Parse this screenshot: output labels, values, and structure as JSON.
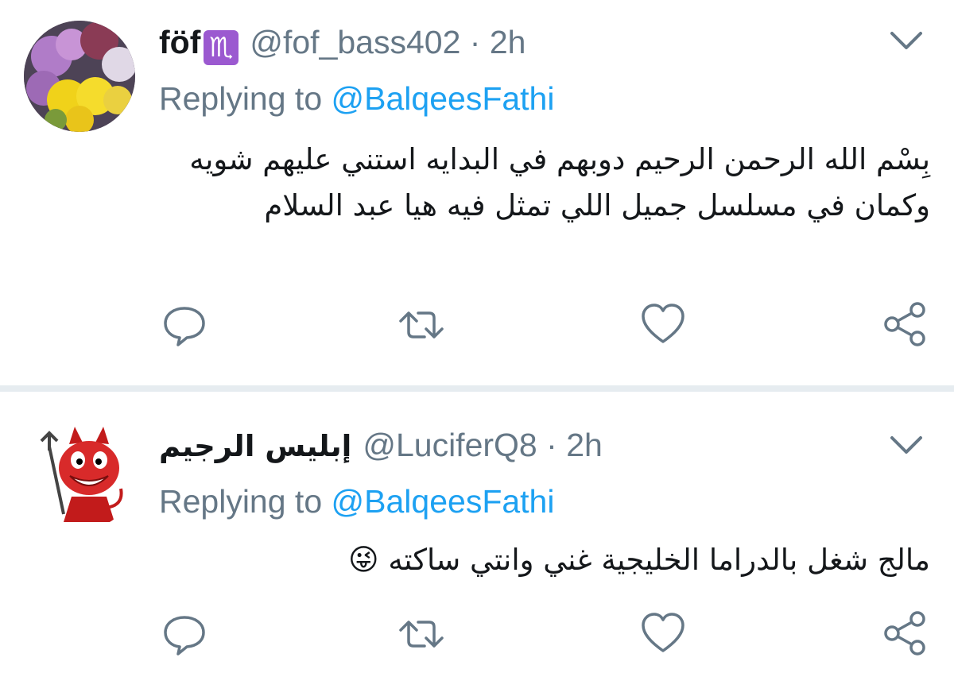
{
  "colors": {
    "text_primary": "#14171a",
    "text_secondary": "#657786",
    "link_blue": "#1da1f2",
    "divider": "#e6ecf0"
  },
  "tweets": [
    {
      "display_name": "föf",
      "badge": "♏",
      "handle": "@fof_bass402",
      "separator": "·",
      "time": "2h",
      "replying_prefix": "Replying to",
      "replying_to": "@BalqeesFathi",
      "text": "بِسْم الله الرحمن الرحيم دوبهم في البدايه استني عليهم شويه وكمان في مسلسل جميل اللي تمثل فيه هيا عبد السلام",
      "icons": [
        "reply-icon",
        "retweet-icon",
        "like-icon",
        "share-icon",
        "chevron-down-icon"
      ]
    },
    {
      "display_name": "إبليس الرجيم",
      "handle": "@LuciferQ8",
      "separator": "·",
      "time": "2h",
      "replying_prefix": "Replying to",
      "replying_to": "@BalqeesFathi",
      "text": "مالج شغل بالدراما الخليجية غني وانتي ساكته 😜",
      "icons": [
        "reply-icon",
        "retweet-icon",
        "like-icon",
        "share-icon",
        "chevron-down-icon"
      ]
    }
  ]
}
